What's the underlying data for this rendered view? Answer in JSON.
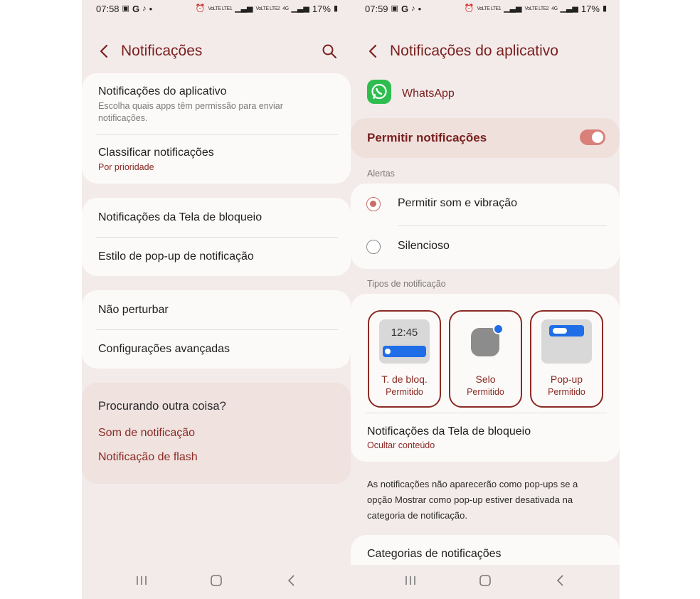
{
  "colors": {
    "accent": "#8b2a24",
    "background": "#f3ebe9",
    "card": "#fcfaf9",
    "toggle_on": "#d9807a",
    "whatsapp": "#2fbd50"
  },
  "left": {
    "status": {
      "time": "07:58",
      "icons_left": [
        "gallery-icon",
        "google-icon",
        "tiktok-icon"
      ],
      "dot": "•",
      "signal_text": "VoLTE LTE1",
      "signal2_text": "VoLTE LTE2",
      "net": "4G",
      "battery": "17%"
    },
    "header": {
      "title": "Notificações"
    },
    "group1": [
      {
        "title": "Notificações do aplicativo",
        "desc": "Escolha quais apps têm permissão para enviar notificações."
      },
      {
        "title": "Classificar notificações",
        "sub": "Por prioridade"
      }
    ],
    "group2": [
      {
        "title": "Notificações da Tela de bloqueio"
      },
      {
        "title": "Estilo de pop-up de notificação"
      }
    ],
    "group3": [
      {
        "title": "Não perturbar"
      },
      {
        "title": "Configurações avançadas"
      }
    ],
    "suggest": {
      "title": "Procurando outra coisa?",
      "links": [
        "Som de notificação",
        "Notificação de flash"
      ]
    }
  },
  "right": {
    "status": {
      "time": "07:59",
      "icons_left": [
        "gallery-icon",
        "google-icon",
        "tiktok-icon"
      ],
      "dot": "•",
      "signal_text": "VoLTE LTE1",
      "signal2_text": "VoLTE LTE2",
      "net": "4G",
      "battery": "17%"
    },
    "header": {
      "title": "Notificações do aplicativo"
    },
    "app": {
      "name": "WhatsApp"
    },
    "allow": {
      "label": "Permitir notificações",
      "enabled": true
    },
    "alerts": {
      "label": "Alertas",
      "options": [
        "Permitir som e vibração",
        "Silencioso"
      ],
      "selected": "Permitir som e vibração"
    },
    "types": {
      "label": "Tipos de notificação",
      "tiles": [
        {
          "label": "T. de bloq.",
          "status": "Permitido",
          "preview_time": "12:45"
        },
        {
          "label": "Selo",
          "status": "Permitido"
        },
        {
          "label": "Pop-up",
          "status": "Permitido"
        }
      ]
    },
    "lock": {
      "title": "Notificações da Tela de bloqueio",
      "sub": "Ocultar conteúdo"
    },
    "info": "As notificações não aparecerão como pop-ups se a opção Mostrar como pop-up estiver desativada na categoria de notificação.",
    "categories": {
      "title": "Categorias de notificações"
    }
  }
}
